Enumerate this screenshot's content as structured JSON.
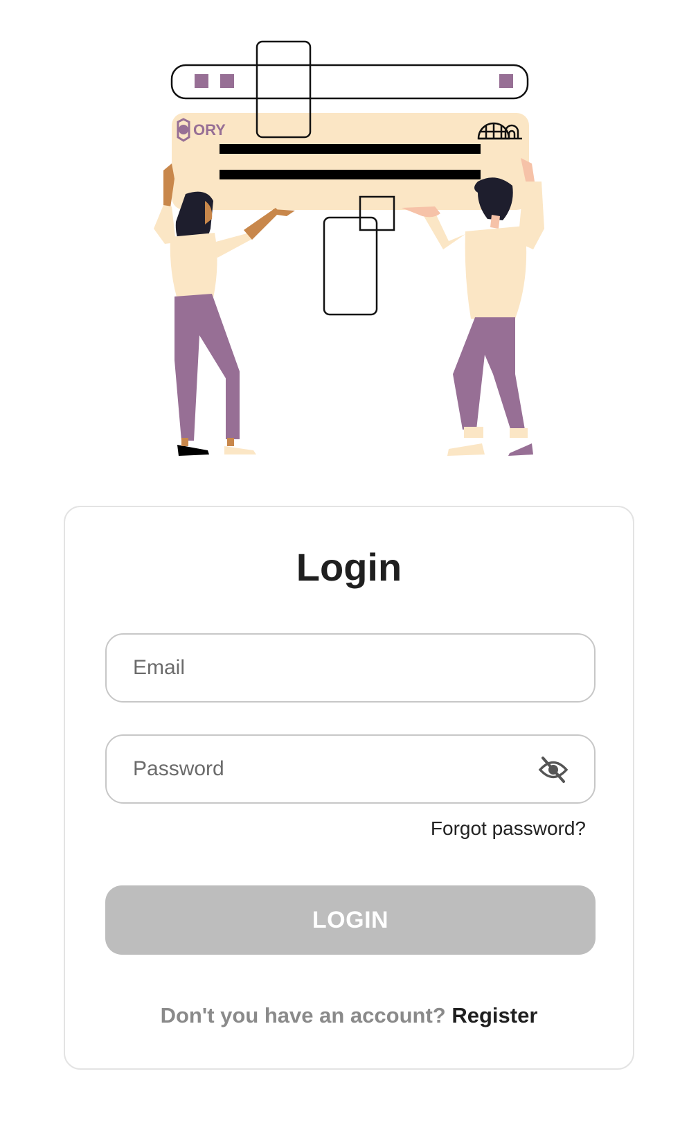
{
  "illustration": {
    "brand_text": "ORY",
    "accent_color": "#976f95",
    "panel_color": "#fbe6c5"
  },
  "login_form": {
    "title": "Login",
    "email_placeholder": "Email",
    "password_placeholder": "Password",
    "password_visibility_icon": "eye-off-icon",
    "forgot_password_label": "Forgot password?",
    "submit_label": "LOGIN",
    "submit_state": "disabled",
    "register_prompt": "Don't you have an account?",
    "register_link": "Register"
  }
}
